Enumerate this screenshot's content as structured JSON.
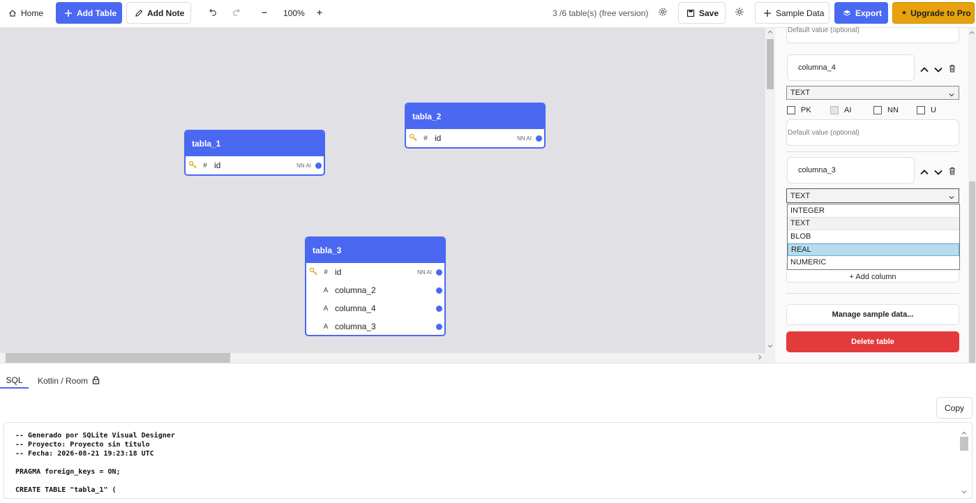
{
  "toolbar": {
    "home": "Home",
    "add_table": "Add Table",
    "add_note": "Add Note",
    "zoom": "100%",
    "table_count": "3 /6  table(s) (free version)",
    "save": "Save",
    "sample_data": "Sample Data",
    "export": "Export",
    "upgrade": "Upgrade to Pro",
    "upgrade_star": "★"
  },
  "colors": {
    "accent": "#4a68f2",
    "danger": "#e33b3b",
    "gold": "#e7a20d",
    "canvas": "#e1e1e5"
  },
  "tables": [
    {
      "name": "tabla_1",
      "columns": [
        {
          "glyph": "#",
          "name": "id",
          "flags": "NN AI",
          "pk": true
        }
      ]
    },
    {
      "name": "tabla_2",
      "columns": [
        {
          "glyph": "#",
          "name": "id",
          "flags": "NN AI",
          "pk": true
        }
      ]
    },
    {
      "name": "tabla_3",
      "columns": [
        {
          "glyph": "#",
          "name": "id",
          "flags": "NN AI",
          "pk": true
        },
        {
          "glyph": "A",
          "name": "columna_2",
          "flags": "",
          "pk": false
        },
        {
          "glyph": "A",
          "name": "columna_4",
          "flags": "",
          "pk": false
        },
        {
          "glyph": "A",
          "name": "columna_3",
          "flags": "",
          "pk": false
        }
      ]
    }
  ],
  "editor": {
    "default_placeholder": "Default value (optional)",
    "col4": {
      "name": "columna_4",
      "type": "TEXT",
      "flags": [
        "PK",
        "AI",
        "NN",
        "U"
      ]
    },
    "col3": {
      "name": "columna_3",
      "type": "TEXT"
    },
    "type_options": [
      "INTEGER",
      "TEXT",
      "BLOB",
      "REAL",
      "NUMERIC"
    ],
    "highlighted_option": "REAL",
    "add_column": "+ Add column",
    "manage_sample": "Manage sample data...",
    "delete_table": "Delete table"
  },
  "bottom": {
    "tab_sql": "SQL",
    "tab_kotlin": "Kotlin / Room",
    "copy": "Copy",
    "code_lines": [
      "-- Generado por SQLite Visual Designer",
      "-- Proyecto: Proyecto sin título",
      "-- Fecha: 2026-08-21 19:23:18 UTC",
      "",
      "PRAGMA foreign_keys = ON;",
      "",
      "CREATE TABLE \"tabla_1\" ("
    ]
  }
}
